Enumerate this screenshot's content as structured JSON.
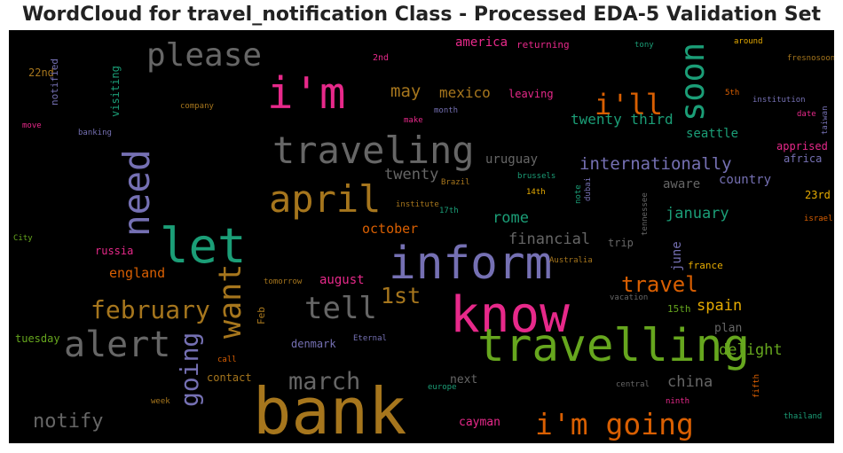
{
  "title": "WordCloud for travel_notification Class - Processed EDA-5 Validation Set",
  "colors": {
    "background": "#000000",
    "pink": "#e7298a",
    "green": "#1b9e77",
    "orange": "#d95f02",
    "purple": "#7570b3",
    "olive": "#66a61e",
    "gold": "#a6761d",
    "yellow": "#e6ab02",
    "grey": "#666666"
  },
  "chart_data": {
    "type": "wordcloud",
    "title": "WordCloud for travel_notification Class - Processed EDA-5 Validation Set",
    "words": [
      {
        "text": "bank",
        "color": "#a6761d",
        "weight": 100
      },
      {
        "text": "know",
        "color": "#e7298a",
        "weight": 78
      },
      {
        "text": "let",
        "color": "#1b9e77",
        "weight": 75
      },
      {
        "text": "inform",
        "color": "#7570b3",
        "weight": 71
      },
      {
        "text": "travelling",
        "color": "#66a61e",
        "weight": 71
      },
      {
        "text": "i'm",
        "color": "#e7298a",
        "weight": 68
      },
      {
        "text": "traveling",
        "color": "#666666",
        "weight": 59
      },
      {
        "text": "april",
        "color": "#a6761d",
        "weight": 59
      },
      {
        "text": "need",
        "color": "#7570b3",
        "weight": 57
      },
      {
        "text": "alert",
        "color": "#666666",
        "weight": 56
      },
      {
        "text": "soon",
        "color": "#1b9e77",
        "weight": 52
      },
      {
        "text": "please",
        "color": "#666666",
        "weight": 50
      },
      {
        "text": "want",
        "color": "#a6761d",
        "weight": 48
      },
      {
        "text": "tell",
        "color": "#666666",
        "weight": 47
      },
      {
        "text": "i'm going",
        "color": "#d95f02",
        "weight": 46
      },
      {
        "text": "i'll",
        "color": "#d95f02",
        "weight": 44
      },
      {
        "text": "february",
        "color": "#a6761d",
        "weight": 39
      },
      {
        "text": "going",
        "color": "#7570b3",
        "weight": 39
      },
      {
        "text": "march",
        "color": "#666666",
        "weight": 38
      },
      {
        "text": "1st",
        "color": "#a6761d",
        "weight": 35
      },
      {
        "text": "travel",
        "color": "#d95f02",
        "weight": 33
      },
      {
        "text": "notify",
        "color": "#666666",
        "weight": 31
      },
      {
        "text": "internationally",
        "color": "#7570b3",
        "weight": 26
      },
      {
        "text": "may",
        "color": "#a6761d",
        "weight": 26
      },
      {
        "text": "twenty",
        "color": "#666666",
        "weight": 24
      },
      {
        "text": "january",
        "color": "#1b9e77",
        "weight": 24
      },
      {
        "text": "rome",
        "color": "#1b9e77",
        "weight": 24
      },
      {
        "text": "china",
        "color": "#666666",
        "weight": 24
      },
      {
        "text": "delight",
        "color": "#66a61e",
        "weight": 24
      },
      {
        "text": "spain",
        "color": "#e6ab02",
        "weight": 24
      },
      {
        "text": "financial",
        "color": "#666666",
        "weight": 23
      },
      {
        "text": "twenty third",
        "color": "#1b9e77",
        "weight": 22
      },
      {
        "text": "mexico",
        "color": "#a6761d",
        "weight": 22
      },
      {
        "text": "england",
        "color": "#d95f02",
        "weight": 21
      },
      {
        "text": "october",
        "color": "#d95f02",
        "weight": 21
      },
      {
        "text": "america",
        "color": "#e7298a",
        "weight": 20
      },
      {
        "text": "uruguay",
        "color": "#666666",
        "weight": 20
      },
      {
        "text": "aware",
        "color": "#666666",
        "weight": 19
      },
      {
        "text": "seattle",
        "color": "#1b9e77",
        "weight": 19
      },
      {
        "text": "country",
        "color": "#7570b3",
        "weight": 19
      },
      {
        "text": "june",
        "color": "#7570b3",
        "weight": 19
      },
      {
        "text": "august",
        "color": "#e7298a",
        "weight": 19
      },
      {
        "text": "cayman",
        "color": "#e7298a",
        "weight": 18
      },
      {
        "text": "next",
        "color": "#666666",
        "weight": 18
      },
      {
        "text": "plan",
        "color": "#666666",
        "weight": 18
      },
      {
        "text": "22nd",
        "color": "#a6761d",
        "weight": 17
      },
      {
        "text": "visiting",
        "color": "#1b9e77",
        "weight": 17
      },
      {
        "text": "leaving",
        "color": "#e7298a",
        "weight": 17
      },
      {
        "text": "russia",
        "color": "#e7298a",
        "weight": 17
      },
      {
        "text": "trip",
        "color": "#666666",
        "weight": 17
      },
      {
        "text": "denmark",
        "color": "#7570b3",
        "weight": 17
      },
      {
        "text": "tuesday",
        "color": "#66a61e",
        "weight": 17
      },
      {
        "text": "contact",
        "color": "#a6761d",
        "weight": 17
      },
      {
        "text": "apprised",
        "color": "#e7298a",
        "weight": 17
      },
      {
        "text": "africa",
        "color": "#7570b3",
        "weight": 17
      },
      {
        "text": "23rd",
        "color": "#e6ab02",
        "weight": 17
      },
      {
        "text": "france",
        "color": "#e6ab02",
        "weight": 15
      },
      {
        "text": "notified",
        "color": "#7570b3",
        "weight": 15
      },
      {
        "text": "Feb",
        "color": "#a6761d",
        "weight": 15
      },
      {
        "text": "15th",
        "color": "#66a61e",
        "weight": 15
      },
      {
        "text": "returning",
        "color": "#e7298a",
        "weight": 15
      },
      {
        "text": "2nd",
        "color": "#e7298a",
        "weight": 14
      },
      {
        "text": "tony",
        "color": "#1b9e77",
        "weight": 12
      },
      {
        "text": "around",
        "color": "#e6ab02",
        "weight": 12
      },
      {
        "text": "fresnosoon",
        "color": "#a6761d",
        "weight": 12
      },
      {
        "text": "5th",
        "color": "#d95f02",
        "weight": 12
      },
      {
        "text": "institution",
        "color": "#7570b3",
        "weight": 12
      },
      {
        "text": "date",
        "color": "#e7298a",
        "weight": 12
      },
      {
        "text": "taiwan",
        "color": "#7570b3",
        "weight": 12
      },
      {
        "text": "company",
        "color": "#a6761d",
        "weight": 12
      },
      {
        "text": "make",
        "color": "#e7298a",
        "weight": 12
      },
      {
        "text": "month",
        "color": "#7570b3",
        "weight": 12
      },
      {
        "text": "move",
        "color": "#e7298a",
        "weight": 12
      },
      {
        "text": "banking",
        "color": "#7570b3",
        "weight": 12
      },
      {
        "text": "brussels",
        "color": "#1b9e77",
        "weight": 12
      },
      {
        "text": "Brazil",
        "color": "#a6761d",
        "weight": 12
      },
      {
        "text": "institute",
        "color": "#a6761d",
        "weight": 12
      },
      {
        "text": "17th",
        "color": "#1b9e77",
        "weight": 12
      },
      {
        "text": "14th",
        "color": "#e6ab02",
        "weight": 12
      },
      {
        "text": "note",
        "color": "#1b9e77",
        "weight": 12
      },
      {
        "text": "dubai",
        "color": "#7570b3",
        "weight": 12
      },
      {
        "text": "tennessee",
        "color": "#666666",
        "weight": 12
      },
      {
        "text": "israel",
        "color": "#d95f02",
        "weight": 12
      },
      {
        "text": "City",
        "color": "#66a61e",
        "weight": 12
      },
      {
        "text": "Australia",
        "color": "#a6761d",
        "weight": 12
      },
      {
        "text": "tomorrow",
        "color": "#a6761d",
        "weight": 12
      },
      {
        "text": "vacation",
        "color": "#666666",
        "weight": 12
      },
      {
        "text": "Eternal",
        "color": "#7570b3",
        "weight": 12
      },
      {
        "text": "call",
        "color": "#d95f02",
        "weight": 12
      },
      {
        "text": "europe",
        "color": "#1b9e77",
        "weight": 12
      },
      {
        "text": "central",
        "color": "#666666",
        "weight": 12
      },
      {
        "text": "fifth",
        "color": "#d95f02",
        "weight": 12
      },
      {
        "text": "week",
        "color": "#a6761d",
        "weight": 12
      },
      {
        "text": "thailand",
        "color": "#1b9e77",
        "weight": 12
      },
      {
        "text": "ninth",
        "color": "#e7298a",
        "weight": 12
      }
    ]
  }
}
